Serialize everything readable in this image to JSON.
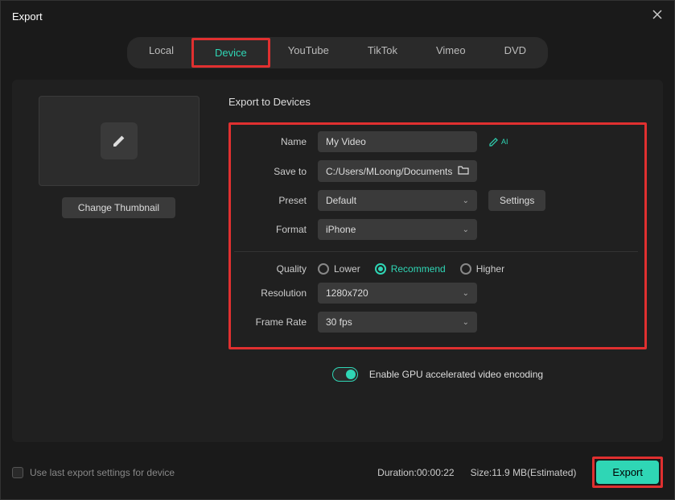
{
  "window": {
    "title": "Export"
  },
  "tabs": {
    "local": "Local",
    "device": "Device",
    "youtube": "YouTube",
    "tiktok": "TikTok",
    "vimeo": "Vimeo",
    "dvd": "DVD",
    "active": "device"
  },
  "thumbnail": {
    "change_label": "Change Thumbnail"
  },
  "section": {
    "title": "Export to Devices"
  },
  "form": {
    "name_label": "Name",
    "name_value": "My Video",
    "ai_label": "AI",
    "saveto_label": "Save to",
    "saveto_value": "C:/Users/MLoong/Documents",
    "preset_label": "Preset",
    "preset_value": "Default",
    "settings_label": "Settings",
    "format_label": "Format",
    "format_value": "iPhone",
    "quality_label": "Quality",
    "quality_lower": "Lower",
    "quality_recommend": "Recommend",
    "quality_higher": "Higher",
    "resolution_label": "Resolution",
    "resolution_value": "1280x720",
    "framerate_label": "Frame Rate",
    "framerate_value": "30 fps"
  },
  "gpu": {
    "label": "Enable GPU accelerated video encoding",
    "enabled": true
  },
  "footer": {
    "use_last_label": "Use last export settings for device",
    "duration_label": "Duration:",
    "duration_value": "00:00:22",
    "size_label": "Size:",
    "size_value": "11.9 MB(Estimated)",
    "export_label": "Export"
  }
}
